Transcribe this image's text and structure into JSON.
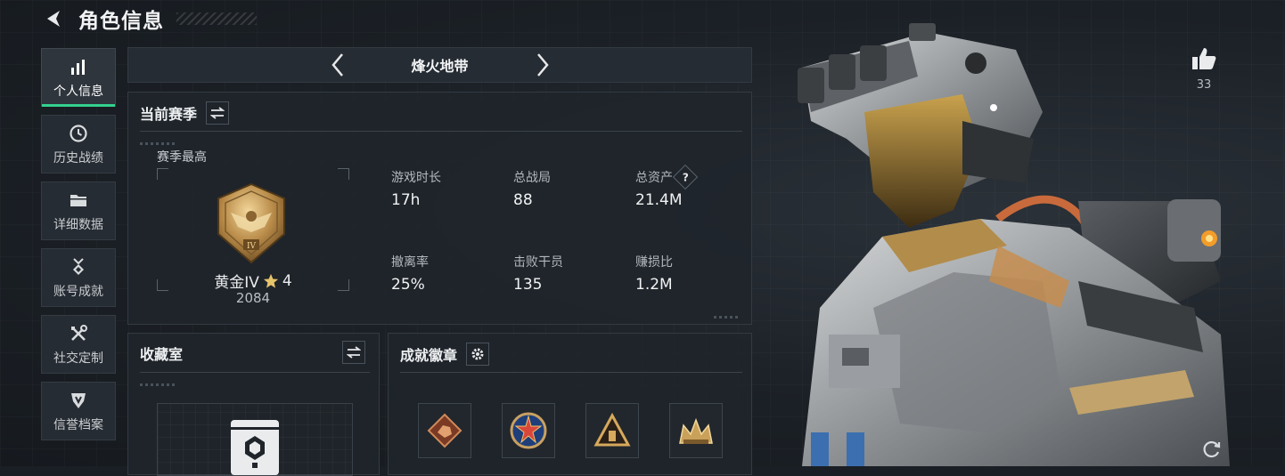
{
  "header": {
    "title": "角色信息"
  },
  "sidebar": {
    "items": [
      {
        "label": "个人信息",
        "icon": "bar-chart-icon",
        "active": true
      },
      {
        "label": "历史战绩",
        "icon": "clock-icon"
      },
      {
        "label": "详细数据",
        "icon": "folder-icon"
      },
      {
        "label": "账号成就",
        "icon": "medal-icon"
      },
      {
        "label": "社交定制",
        "icon": "tools-icon"
      },
      {
        "label": "信誉档案",
        "icon": "shield-icon"
      }
    ]
  },
  "mode": {
    "title": "烽火地带"
  },
  "season": {
    "title": "当前赛季",
    "best_label": "赛季最高",
    "rank_name": "黄金IV",
    "rank_stars": "4",
    "rank_score": "2084",
    "stats": [
      {
        "label": "游戏时长",
        "value": "17h"
      },
      {
        "label": "总战局",
        "value": "88"
      },
      {
        "label": "总资产",
        "value": "21.4M",
        "help": "?"
      },
      {
        "label": "撤离率",
        "value": "25%"
      },
      {
        "label": "击败干员",
        "value": "135"
      },
      {
        "label": "赚损比",
        "value": "1.2M"
      }
    ]
  },
  "collection": {
    "title": "收藏室"
  },
  "achievements": {
    "title": "成就徽章"
  },
  "likes": {
    "count": "33"
  },
  "colors": {
    "accent": "#33d18f",
    "gold": "#c9a062",
    "panel": "#20252b"
  }
}
